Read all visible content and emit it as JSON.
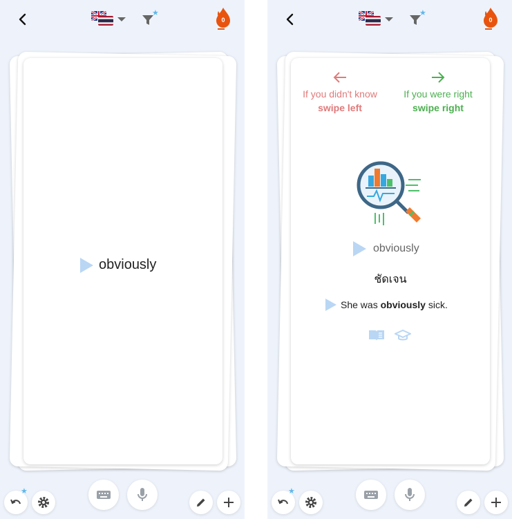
{
  "screens": [
    {
      "id": "front",
      "word": "obviously"
    },
    {
      "id": "back",
      "hints": {
        "left_line1": "If you didn't know",
        "left_line2": "swipe left",
        "right_line1": "If you were right",
        "right_line2": "swipe right"
      },
      "word": "obviously",
      "translation": "ชัดเจน",
      "example": {
        "before": "She was ",
        "highlight": "obviously",
        "after": " sick."
      }
    }
  ],
  "topbar": {
    "streak_count": "0"
  },
  "colors": {
    "background": "#eef3fb",
    "play_icon": "#b9d6f4",
    "swipe_left": "#e07a7a",
    "swipe_right": "#4caf50",
    "streak": "#e8540f",
    "star_badge": "#5fb7ea"
  },
  "icons": {
    "back": "chevron-left-icon",
    "filter": "filter-icon",
    "streak": "fire-drop-icon",
    "undo": "undo-icon",
    "settings": "gear-icon",
    "keyboard": "keyboard-icon",
    "mic": "microphone-icon",
    "edit": "pencil-icon",
    "add": "plus-icon",
    "dictionary": "book-icon",
    "learn": "graduation-cap-icon"
  }
}
